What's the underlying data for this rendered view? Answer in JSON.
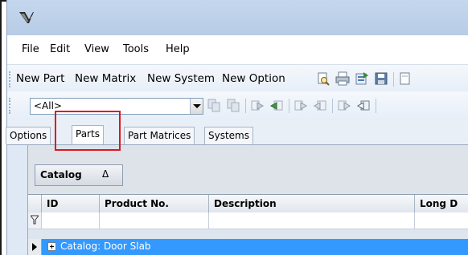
{
  "menu": {
    "items": [
      {
        "label": "File"
      },
      {
        "label": "Edit"
      },
      {
        "label": "View"
      },
      {
        "label": "Tools"
      },
      {
        "label": "Help"
      }
    ]
  },
  "toolbar": {
    "buttons": [
      {
        "label": "New Part"
      },
      {
        "label": "New Matrix"
      },
      {
        "label": "New System"
      },
      {
        "label": "New Option"
      }
    ],
    "icons": [
      "print-preview-icon",
      "print-icon",
      "export-icon",
      "save-icon"
    ]
  },
  "filter_toolbar": {
    "combo_value": "<All>",
    "icons": [
      "copy-icon",
      "paste-icon",
      "move-right-icon",
      "move-left-icon",
      "indent-right-icon",
      "outdent-left-icon",
      "send-icon",
      "receive-icon"
    ]
  },
  "tabs": [
    {
      "label": "Options",
      "active": false
    },
    {
      "label": "Parts",
      "active": true
    },
    {
      "label": "Part Matrices",
      "active": false
    },
    {
      "label": "Systems",
      "active": false
    }
  ],
  "grid": {
    "group_by": {
      "label": "Catalog",
      "sort": "Δ"
    },
    "columns": [
      {
        "label": "ID"
      },
      {
        "label": "Product No."
      },
      {
        "label": "Description"
      },
      {
        "label": "Long D"
      }
    ],
    "group_rows": [
      {
        "label": "Catalog: Door Slab",
        "selected": true
      }
    ]
  },
  "highlight_color": "#e0141e",
  "selection_color": "#3399ff"
}
